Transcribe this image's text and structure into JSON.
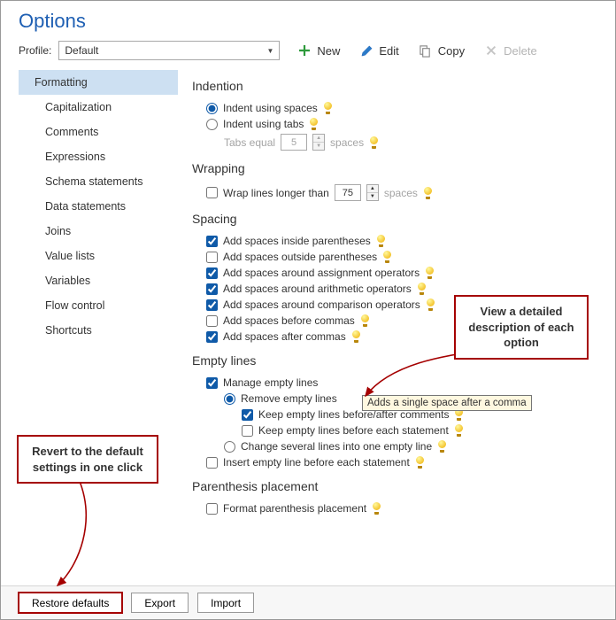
{
  "title": "Options",
  "profile": {
    "label": "Profile:",
    "selected": "Default",
    "toolbar": {
      "new": "New",
      "edit": "Edit",
      "copy": "Copy",
      "delete": "Delete"
    }
  },
  "sidebar": {
    "items": [
      "Formatting",
      "Capitalization",
      "Comments",
      "Expressions",
      "Schema statements",
      "Data statements",
      "Joins",
      "Value lists",
      "Variables",
      "Flow control",
      "Shortcuts"
    ]
  },
  "sections": {
    "indention": {
      "heading": "Indention",
      "opt_spaces": "Indent using spaces",
      "opt_tabs": "Indent using tabs",
      "tabs_equal": "Tabs equal",
      "tabs_value": "5",
      "tabs_suffix": "spaces"
    },
    "wrapping": {
      "heading": "Wrapping",
      "opt_longer": "Wrap lines longer than",
      "value": "75",
      "suffix": "spaces"
    },
    "spacing": {
      "heading": "Spacing",
      "inside_paren": "Add spaces inside parentheses",
      "outside_paren": "Add spaces outside parentheses",
      "assignment": "Add spaces around assignment operators",
      "arithmetic": "Add spaces around arithmetic operators",
      "comparison": "Add spaces around comparison operators",
      "before_commas": "Add spaces before commas",
      "after_commas": "Add spaces after commas"
    },
    "empty": {
      "heading": "Empty lines",
      "manage": "Manage empty lines",
      "remove": "Remove empty lines",
      "keep_comments": "Keep empty lines before/after comments",
      "keep_statement": "Keep empty lines before each statement",
      "change": "Change several lines into one empty line",
      "insert": "Insert empty line before each statement"
    },
    "paren": {
      "heading": "Parenthesis placement",
      "format": "Format parenthesis placement"
    }
  },
  "callouts": {
    "view_detail": "View a detailed description of each option",
    "revert": "Revert to the default settings in one click",
    "tooltip": "Adds a single space after a comma"
  },
  "footer": {
    "restore": "Restore defaults",
    "export": "Export",
    "import": "Import"
  }
}
